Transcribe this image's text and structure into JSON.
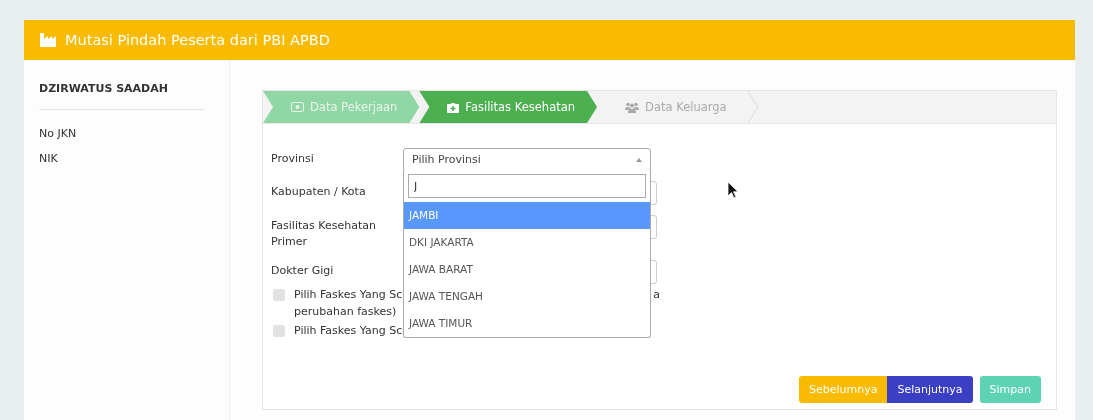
{
  "header": {
    "title": "Mutasi Pindah Peserta dari PBI APBD"
  },
  "participant": {
    "name": "DZIRWATUS SAADAH",
    "fields": [
      {
        "label": "No JKN"
      },
      {
        "label": "NIK"
      }
    ]
  },
  "steps": [
    {
      "label": "Data Pekerjaan",
      "completed": true,
      "selected": false
    },
    {
      "label": "Fasilitas Kesehatan",
      "completed": false,
      "selected": true
    },
    {
      "label": "Data Keluarga",
      "completed": false,
      "selected": false
    }
  ],
  "form": {
    "fields": [
      {
        "label": "Provinsi",
        "kind": "select",
        "placeholder": "Pilih Provinsi",
        "expanded": true
      },
      {
        "label": "Kabupaten / Kota",
        "kind": "input"
      },
      {
        "label": "Fasilitas Kesehatan Primer",
        "kind": "input"
      },
      {
        "label": "Dokter Gigi",
        "kind": "input"
      }
    ],
    "dropdown": {
      "search": "J",
      "options": [
        {
          "label": "JAMBI",
          "selected": true
        },
        {
          "label": "DKI JAKARTA",
          "selected": false
        },
        {
          "label": "JAWA BARAT",
          "selected": false
        },
        {
          "label": "JAWA TENGAH",
          "selected": false
        },
        {
          "label": "JAWA TIMUR",
          "selected": false
        }
      ]
    },
    "checkboxes": [
      {
        "checked": false,
        "lines": [
          [
            "Pilih Faskes Yang Sc",
            "a"
          ],
          [
            "perubahan faskes)"
          ]
        ]
      },
      {
        "checked": false,
        "lines": [
          [
            "Pilih Faskes Yang Sc"
          ]
        ]
      }
    ]
  },
  "buttons": [
    {
      "label": "Sebelumnya",
      "kind": "previous"
    },
    {
      "label": "Selanjutnya",
      "kind": "next"
    },
    {
      "label": "Simpan",
      "kind": "save"
    }
  ]
}
